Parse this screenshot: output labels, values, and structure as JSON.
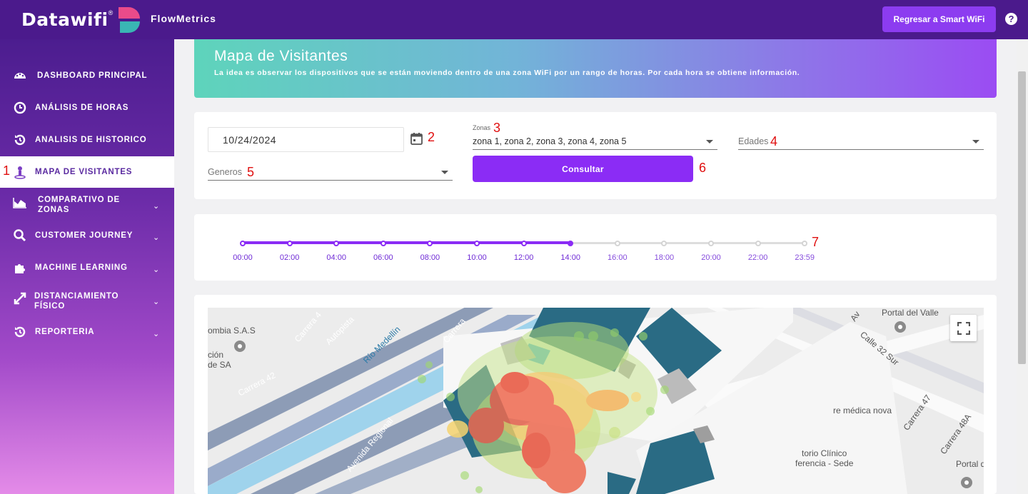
{
  "header": {
    "logo_text": "Datawifi",
    "logo_mark": "®",
    "app_name": "FlowMetrics",
    "return_button": "Regresar a Smart WiFi",
    "help_icon": "?"
  },
  "sidebar": {
    "items": [
      {
        "label": "DASHBOARD PRINCIPAL",
        "icon": "dashboard-icon"
      },
      {
        "label": "ANÁLISIS DE HORAS",
        "icon": "clock-icon"
      },
      {
        "label": "ANALISIS DE HISTORICO",
        "icon": "history-icon"
      },
      {
        "label": "MAPA DE VISITANTES",
        "icon": "person-pin-icon",
        "active": true,
        "marker": "1"
      },
      {
        "label": "COMPARATIVO DE ZONAS",
        "icon": "area-chart-icon"
      },
      {
        "label": "CUSTOMER JOURNEY",
        "icon": "search-icon"
      },
      {
        "label": "MACHINE LEARNING",
        "icon": "puzzle-icon"
      },
      {
        "label": "DISTANCIAMIENTO FÍSICO",
        "icon": "expand-arrows-icon"
      },
      {
        "label": "REPORTERIA",
        "icon": "history-icon"
      }
    ]
  },
  "banner": {
    "title": "Mapa de Visitantes",
    "subtitle": "La idea es observar los dispositivos que se están moviendo dentro de una zona WiFi por un rango de horas. Por cada hora se obtiene información."
  },
  "filters": {
    "date_value": "10/24/2024",
    "date_marker": "2",
    "zonas_label": "Zonas",
    "zonas_marker": "3",
    "zonas_value": "zona 1, zona 2, zona 3, zona 4, zona 5",
    "edades_placeholder": "Edades",
    "edades_marker": "4",
    "generos_placeholder": "Generos",
    "generos_marker": "5",
    "consult_button": "Consultar",
    "consult_marker": "6"
  },
  "timeline": {
    "ticks": [
      "00:00",
      "02:00",
      "04:00",
      "06:00",
      "08:00",
      "10:00",
      "12:00",
      "14:00",
      "16:00",
      "18:00",
      "20:00",
      "22:00",
      "23:59"
    ],
    "selected_index": 7,
    "marker": "7",
    "active_color": "#8b2cf5",
    "inactive_color": "#dddddd"
  },
  "map": {
    "labels": [
      "Portal del Valle",
      "Calle 32 Sur",
      "Carrera 42",
      "Autopista",
      "Río Medellín",
      "Carrera",
      "Avenida Regional",
      "Carrera 47",
      "Carrera 48A",
      "Portal d",
      "ombia S.A.S",
      "ción",
      "de SA",
      "re médica nova",
      "torio Clínico",
      "ferencia - Sede",
      "Av",
      "Carrera 4"
    ],
    "fullscreen_icon": "fullscreen-icon"
  }
}
